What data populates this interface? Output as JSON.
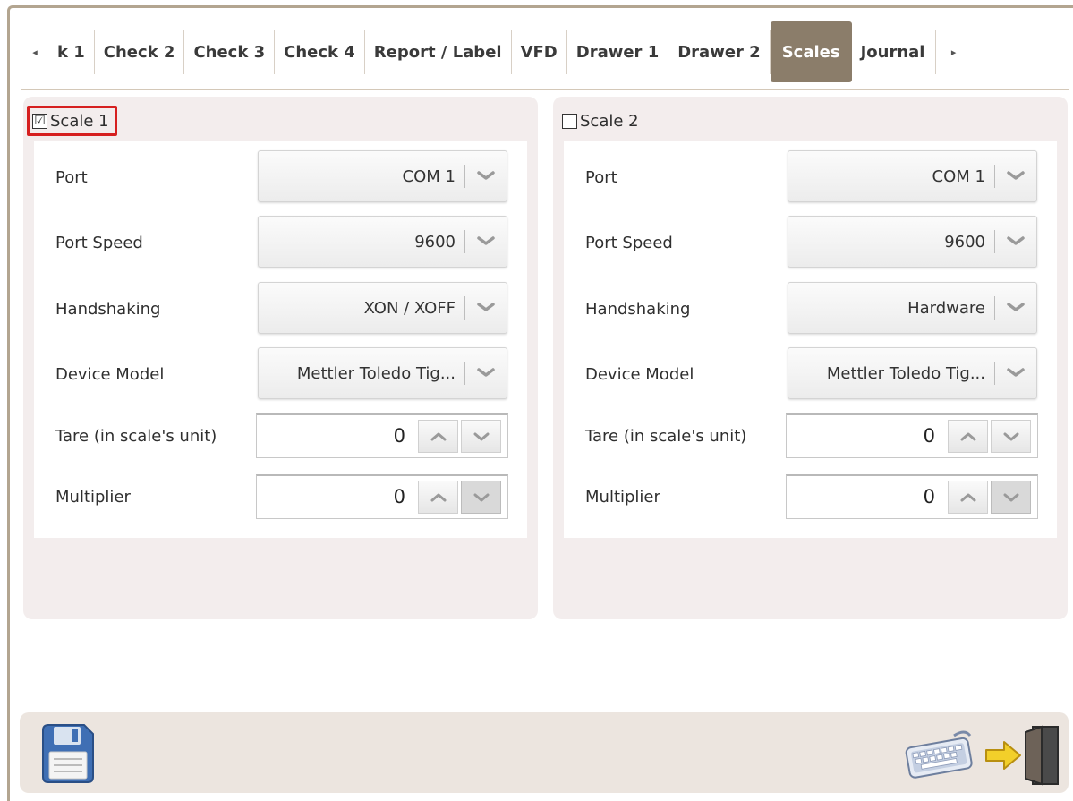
{
  "tabs": {
    "prev_glyph": "◂",
    "next_glyph": "▸",
    "items": [
      {
        "label": "k 1"
      },
      {
        "label": "Check 2"
      },
      {
        "label": "Check 3"
      },
      {
        "label": "Check 4"
      },
      {
        "label": "Report / Label"
      },
      {
        "label": "VFD"
      },
      {
        "label": "Drawer 1"
      },
      {
        "label": "Drawer 2"
      },
      {
        "label": "Scales",
        "active": true
      },
      {
        "label": "Journal"
      }
    ]
  },
  "scale1": {
    "label": "Scale 1",
    "checked": true,
    "check_glyph": "☑",
    "port_label": "Port",
    "port_value": "COM 1",
    "speed_label": "Port Speed",
    "speed_value": "9600",
    "handshake_label": "Handshaking",
    "handshake_value": "XON / XOFF",
    "model_label": "Device Model",
    "model_value": "Mettler Toledo Tig...",
    "tare_label": "Tare (in scale's unit)",
    "tare_value": "0",
    "multiplier_label": "Multiplier",
    "multiplier_value": "0"
  },
  "scale2": {
    "label": "Scale 2",
    "checked": false,
    "port_label": "Port",
    "port_value": "COM 1",
    "speed_label": "Port Speed",
    "speed_value": "9600",
    "handshake_label": "Handshaking",
    "handshake_value": "Hardware",
    "model_label": "Device Model",
    "model_value": "Mettler Toledo Tig...",
    "tare_label": "Tare (in scale's unit)",
    "tare_value": "0",
    "multiplier_label": "Multiplier",
    "multiplier_value": "0"
  },
  "icons": {
    "save": "save-icon",
    "keyboard": "keyboard-icon",
    "exit": "exit-door-icon",
    "dropdown": "chevron-down-icon",
    "spin_up": "chevron-up-icon"
  },
  "colors": {
    "active_tab": "#8b7d6a",
    "panel_bg": "#f3eded",
    "highlight": "#d62020",
    "frame": "#b3a590"
  }
}
